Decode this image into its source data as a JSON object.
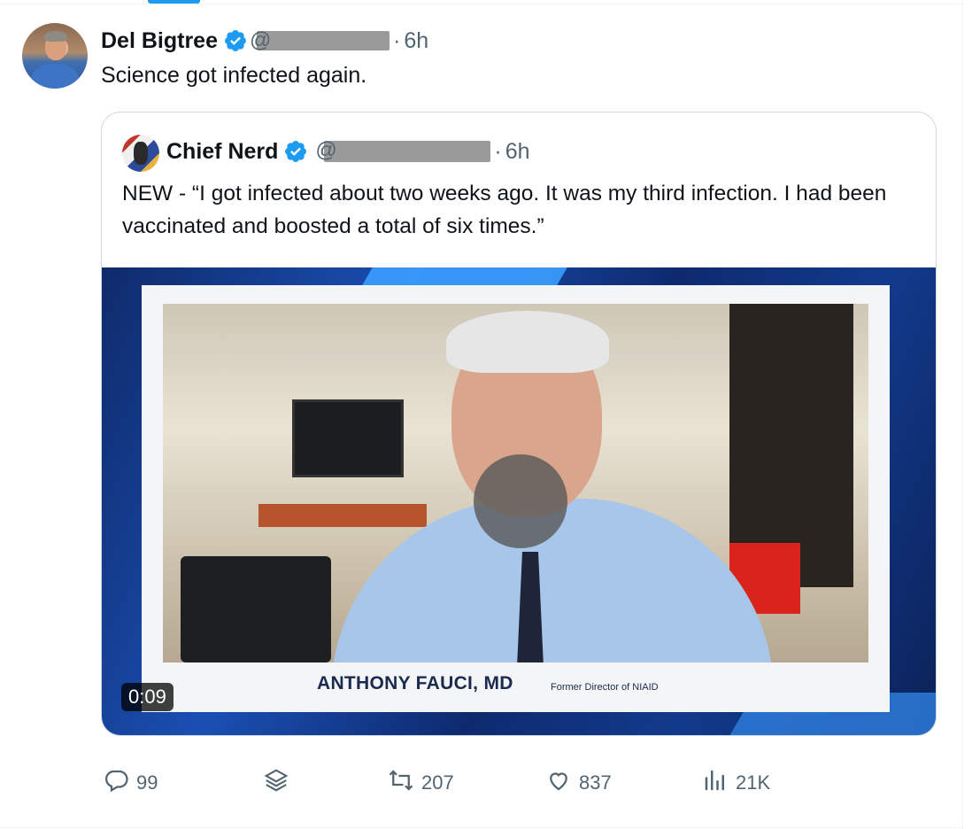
{
  "post": {
    "author_name": "Del Bigtree",
    "time": "6h",
    "text": "Science got infected again."
  },
  "quote": {
    "author_name": "Chief Nerd",
    "time": "6h",
    "text": "NEW - “I got infected about two weeks ago. It was my third infection. I had been vaccinated and boosted a total of six times.”",
    "media": {
      "duration": "0:09",
      "caption_name": "ANTHONY FAUCI, MD",
      "caption_title": "Former Director of NIAID"
    }
  },
  "actions": {
    "replies": "99",
    "reposts": "207",
    "likes": "837",
    "views": "21K"
  },
  "icons": {
    "verified": "verified-badge-icon",
    "reply": "reply-icon",
    "stack": "stack-icon",
    "repost": "repost-icon",
    "like": "heart-icon",
    "views": "views-icon"
  },
  "colors": {
    "accent": "#1d9bf0",
    "secondary_text": "#536471",
    "border": "#cfd9de"
  }
}
